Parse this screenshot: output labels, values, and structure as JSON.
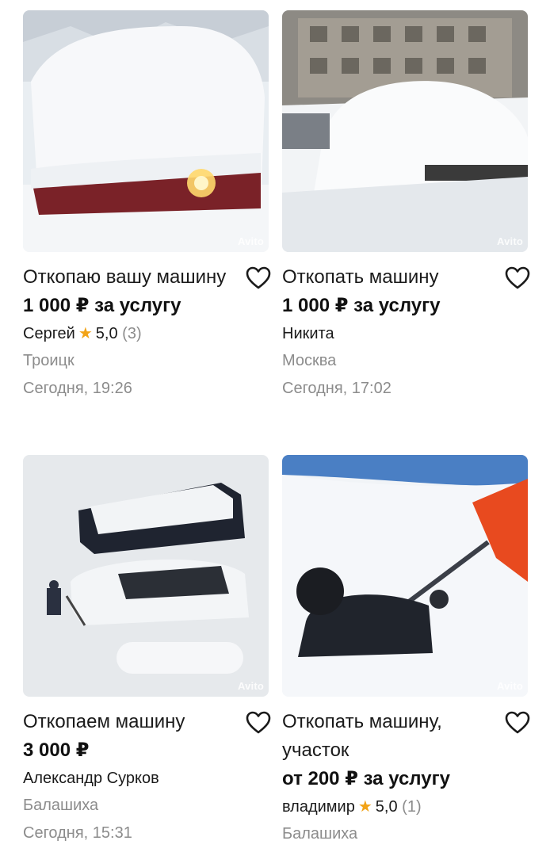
{
  "watermark": "Avito",
  "cards": [
    {
      "title": "Откопаю вашу машину",
      "price": "1 000 ₽ за услугу",
      "seller": "Сергей",
      "rating": "5,0",
      "reviews": "(3)",
      "location": "Троицк",
      "date": "Сегодня, 19:26"
    },
    {
      "title": "Откопать машину",
      "price": "1 000 ₽ за услугу",
      "seller": "Никита",
      "location": "Москва",
      "date": "Сегодня, 17:02"
    },
    {
      "title": "Откопаем машину",
      "price": "3 000 ₽",
      "seller": "Александр Сурков",
      "location": "Балашиха",
      "date": "Сегодня, 15:31"
    },
    {
      "title": "Откопать машину, участок",
      "price": "от 200 ₽ за услугу",
      "seller": "владимир",
      "rating": "5,0",
      "reviews": "(1)",
      "location": "Балашиха"
    }
  ]
}
